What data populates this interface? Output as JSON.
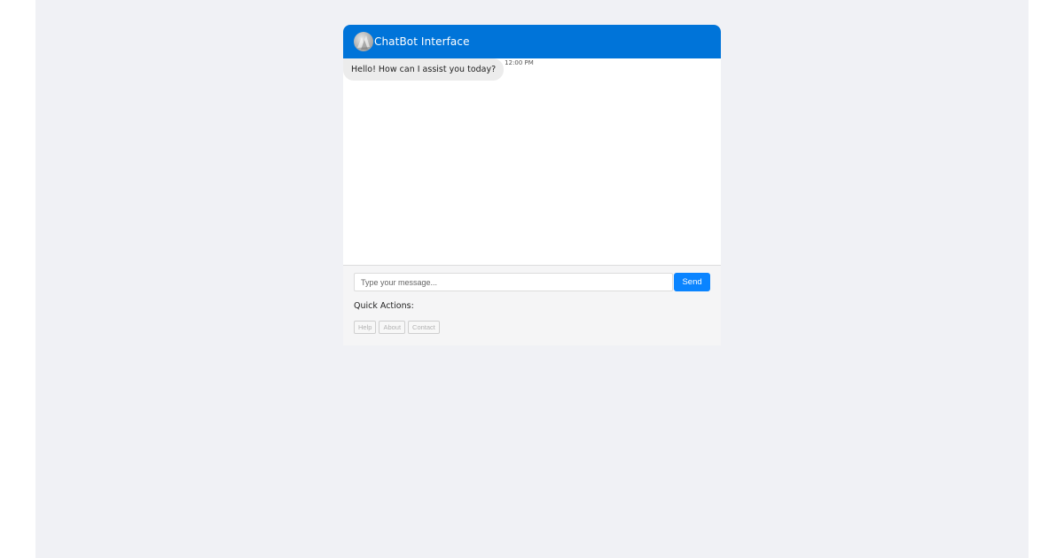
{
  "header": {
    "title": "ChatBot Interface",
    "avatar_icon": "bot-avatar-icon",
    "color": "#0074d9"
  },
  "messages": [
    {
      "sender": "bot",
      "text": "Hello! How can I assist you today?",
      "time": "12:00 PM"
    }
  ],
  "composer": {
    "placeholder": "Type your message...",
    "value": "",
    "send_label": "Send",
    "send_color": "#0a84ff"
  },
  "quick_actions": {
    "label": "Quick Actions:",
    "items": [
      {
        "label": "Help"
      },
      {
        "label": "About"
      },
      {
        "label": "Contact"
      }
    ]
  }
}
